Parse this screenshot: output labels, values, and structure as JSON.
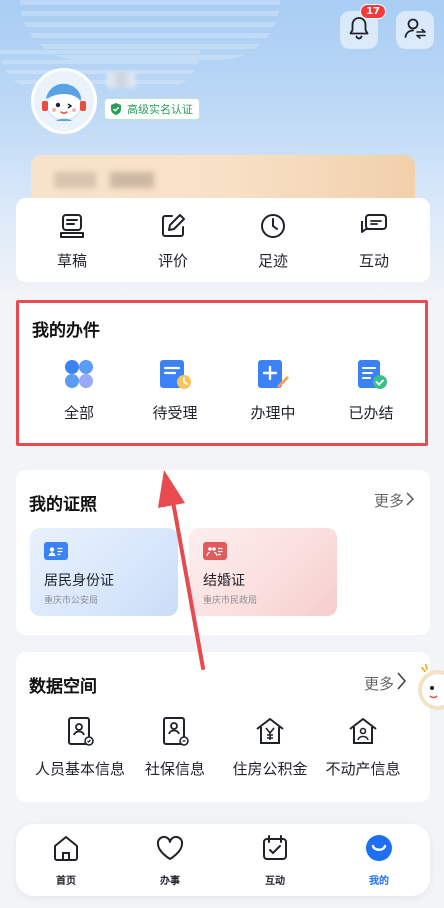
{
  "header": {
    "notification_count": "17",
    "verify_label": "高级实名认证"
  },
  "quick_actions": [
    {
      "label": "草稿",
      "icon": "draft-icon"
    },
    {
      "label": "评价",
      "icon": "edit-icon"
    },
    {
      "label": "足迹",
      "icon": "clock-icon"
    },
    {
      "label": "互动",
      "icon": "chat-icon"
    }
  ],
  "my_works": {
    "title": "我的办件",
    "items": [
      {
        "label": "全部",
        "icon": "grid-icon"
      },
      {
        "label": "待受理",
        "icon": "pending-doc-icon"
      },
      {
        "label": "办理中",
        "icon": "processing-doc-icon"
      },
      {
        "label": "已办结",
        "icon": "done-doc-icon"
      }
    ]
  },
  "my_licenses": {
    "title": "我的证照",
    "more": "更多",
    "cards": [
      {
        "name": "居民身份证",
        "org": "重庆市公安局",
        "color": "#3b82f6"
      },
      {
        "name": "结婚证",
        "org": "重庆市民政局",
        "color": "#e25a5a"
      }
    ]
  },
  "data_space": {
    "title": "数据空间",
    "more": "更多",
    "items": [
      {
        "label": "人员基本信息",
        "icon": "person-doc-icon"
      },
      {
        "label": "社保信息",
        "icon": "social-security-icon"
      },
      {
        "label": "住房公积金",
        "icon": "housing-fund-icon"
      },
      {
        "label": "不动产信息",
        "icon": "real-estate-icon"
      }
    ]
  },
  "tabbar": [
    {
      "label": "首页",
      "icon": "home-icon"
    },
    {
      "label": "办事",
      "icon": "heart-icon"
    },
    {
      "label": "互动",
      "icon": "calendar-check-icon"
    },
    {
      "label": "我的",
      "icon": "profile-smile-icon",
      "active": true
    }
  ],
  "colors": {
    "accent": "#1f6ff2",
    "highlight_border": "#e84a4f",
    "verified_green": "#2a9d5a"
  }
}
